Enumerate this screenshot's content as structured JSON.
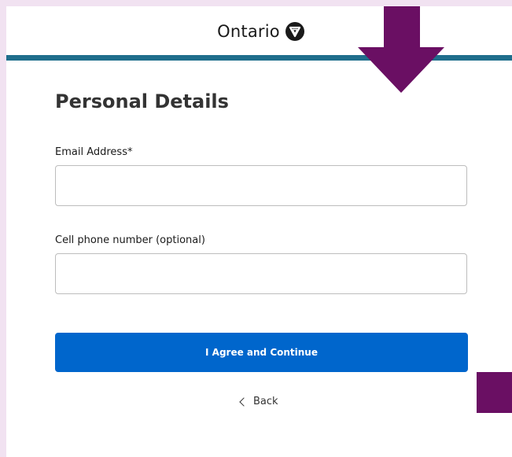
{
  "header": {
    "brand_name": "Ontario",
    "logo_icon": "ontario-trillium-icon",
    "accent_bar_color": "#1f6e8c"
  },
  "form": {
    "title": "Personal Details",
    "email": {
      "label": "Email Address*",
      "value": "",
      "placeholder": ""
    },
    "phone": {
      "label": "Cell phone number (optional)",
      "value": "",
      "placeholder": ""
    },
    "submit_label": "I Agree and Continue",
    "submit_color": "#0066cc",
    "back_label": "Back",
    "back_icon": "chevron-left-icon"
  },
  "annotations": {
    "arrow_color": "#6a0f63",
    "square_color": "#6a0f63"
  }
}
